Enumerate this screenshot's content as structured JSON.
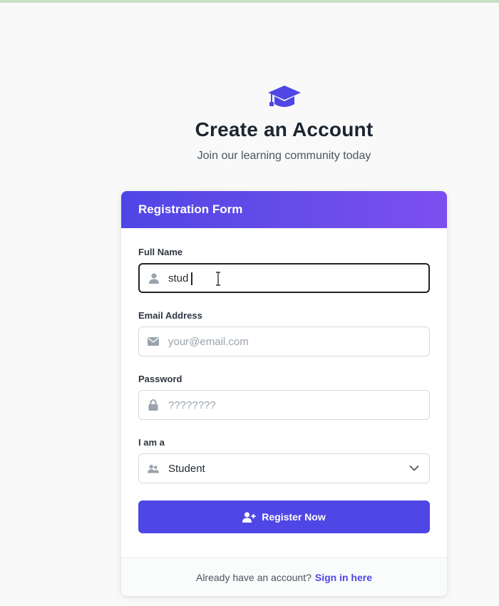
{
  "hero": {
    "title": "Create an Account",
    "subtitle": "Join our learning community today",
    "icon": "graduation-cap-icon"
  },
  "form": {
    "header_title": "Registration Form",
    "full_name": {
      "label": "Full Name",
      "value": "stud",
      "icon": "user-icon"
    },
    "email": {
      "label": "Email Address",
      "placeholder": "your@email.com",
      "icon": "envelope-icon"
    },
    "password": {
      "label": "Password",
      "placeholder": "????????",
      "icon": "lock-icon"
    },
    "role": {
      "label": "I am a",
      "selected": "Student",
      "icon": "users-icon"
    },
    "submit_label": "Register Now",
    "submit_icon": "user-plus-icon"
  },
  "footer": {
    "prompt": "Already have an account?",
    "link_label": "Sign in here"
  },
  "colors": {
    "accent": "#4f46e5",
    "header_gradient_end": "#7c4ef0",
    "background": "#f8f9f8"
  }
}
